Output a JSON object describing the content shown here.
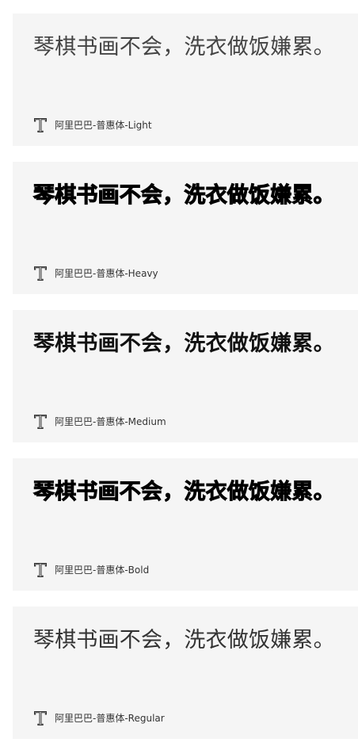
{
  "sample_text": "琴棋书画不会，洗衣做饭嫌累。",
  "fonts": [
    {
      "name": "阿里巴巴-普惠体-Light",
      "icon": "font-icon"
    },
    {
      "name": "阿里巴巴-普惠体-Heavy",
      "icon": "font-icon"
    },
    {
      "name": "阿里巴巴-普惠体-Medium",
      "icon": "font-icon"
    },
    {
      "name": "阿里巴巴-普惠体-Bold",
      "icon": "font-icon"
    },
    {
      "name": "阿里巴巴-普惠体-Regular",
      "icon": "font-icon"
    }
  ],
  "colors": {
    "card_background": "#f5f5f5",
    "text": "#000000",
    "label_text": "#333333"
  }
}
